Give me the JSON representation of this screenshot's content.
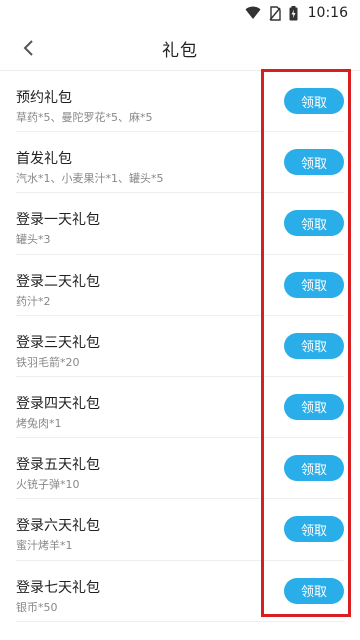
{
  "status_bar": {
    "time": "10:16"
  },
  "header": {
    "title": "礼包"
  },
  "gifts": [
    {
      "name": "预约礼包",
      "items": "草药*5、曼陀罗花*5、麻*5",
      "button": "领取"
    },
    {
      "name": "首发礼包",
      "items": "汽水*1、小麦果汁*1、罐头*5",
      "button": "领取"
    },
    {
      "name": "登录一天礼包",
      "items": "罐头*3",
      "button": "领取"
    },
    {
      "name": "登录二天礼包",
      "items": "药汁*2",
      "button": "领取"
    },
    {
      "name": "登录三天礼包",
      "items": "铁羽毛箭*20",
      "button": "领取"
    },
    {
      "name": "登录四天礼包",
      "items": "烤兔肉*1",
      "button": "领取"
    },
    {
      "name": "登录五天礼包",
      "items": "火铳子弹*10",
      "button": "领取"
    },
    {
      "name": "登录六天礼包",
      "items": "蜜汁烤羊*1",
      "button": "领取"
    },
    {
      "name": "登录七天礼包",
      "items": "银币*50",
      "button": "领取"
    }
  ],
  "colors": {
    "button": "#29aee9",
    "highlight": "#d81e1e"
  }
}
